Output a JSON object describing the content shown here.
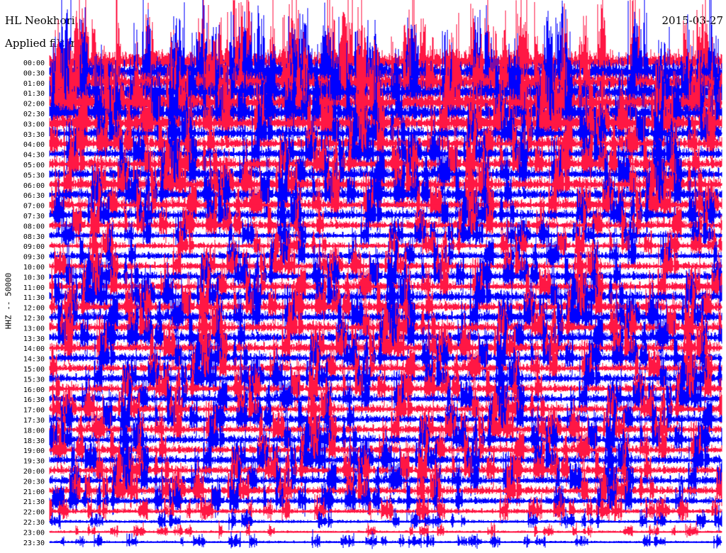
{
  "header": {
    "station": "HL Neokhori",
    "date": "2015-03-27",
    "filter": "Applied filter"
  },
  "chart_data": {
    "type": "line",
    "title": "",
    "ylabel": "HHZ -- 50000",
    "rows": [
      "00:00",
      "00:30",
      "01:00",
      "01:30",
      "02:00",
      "02:30",
      "03:00",
      "03:30",
      "04:00",
      "04:30",
      "05:00",
      "05:30",
      "06:00",
      "06:30",
      "07:00",
      "07:30",
      "08:00",
      "08:30",
      "09:00",
      "09:30",
      "10:00",
      "10:30",
      "11:00",
      "11:30",
      "12:00",
      "12:30",
      "13:00",
      "13:30",
      "14:00",
      "14:30",
      "15:00",
      "15:30",
      "16:00",
      "16:30",
      "17:00",
      "17:30",
      "18:00",
      "18:30",
      "19:00",
      "19:30",
      "20:00",
      "20:30",
      "21:00",
      "21:30",
      "22:00",
      "22:30",
      "23:00",
      "23:30"
    ],
    "series_colors": [
      "#ff1744",
      "#0000ff"
    ],
    "row_amplitude": [
      3.4,
      3.4,
      3.2,
      3.2,
      3.0,
      2.8,
      2.6,
      1.9,
      1.9,
      1.7,
      1.9,
      1.9,
      1.9,
      1.9,
      1.7,
      1.7,
      1.5,
      1.1,
      1.1,
      1.3,
      1.3,
      1.5,
      1.5,
      1.7,
      1.7,
      1.7,
      1.7,
      1.7,
      1.7,
      1.5,
      1.5,
      1.5,
      1.5,
      1.5,
      1.5,
      1.5,
      1.5,
      1.5,
      1.5,
      1.5,
      1.5,
      1.5,
      1.5,
      1.3,
      0.9,
      0.6,
      0.45,
      0.45
    ]
  }
}
